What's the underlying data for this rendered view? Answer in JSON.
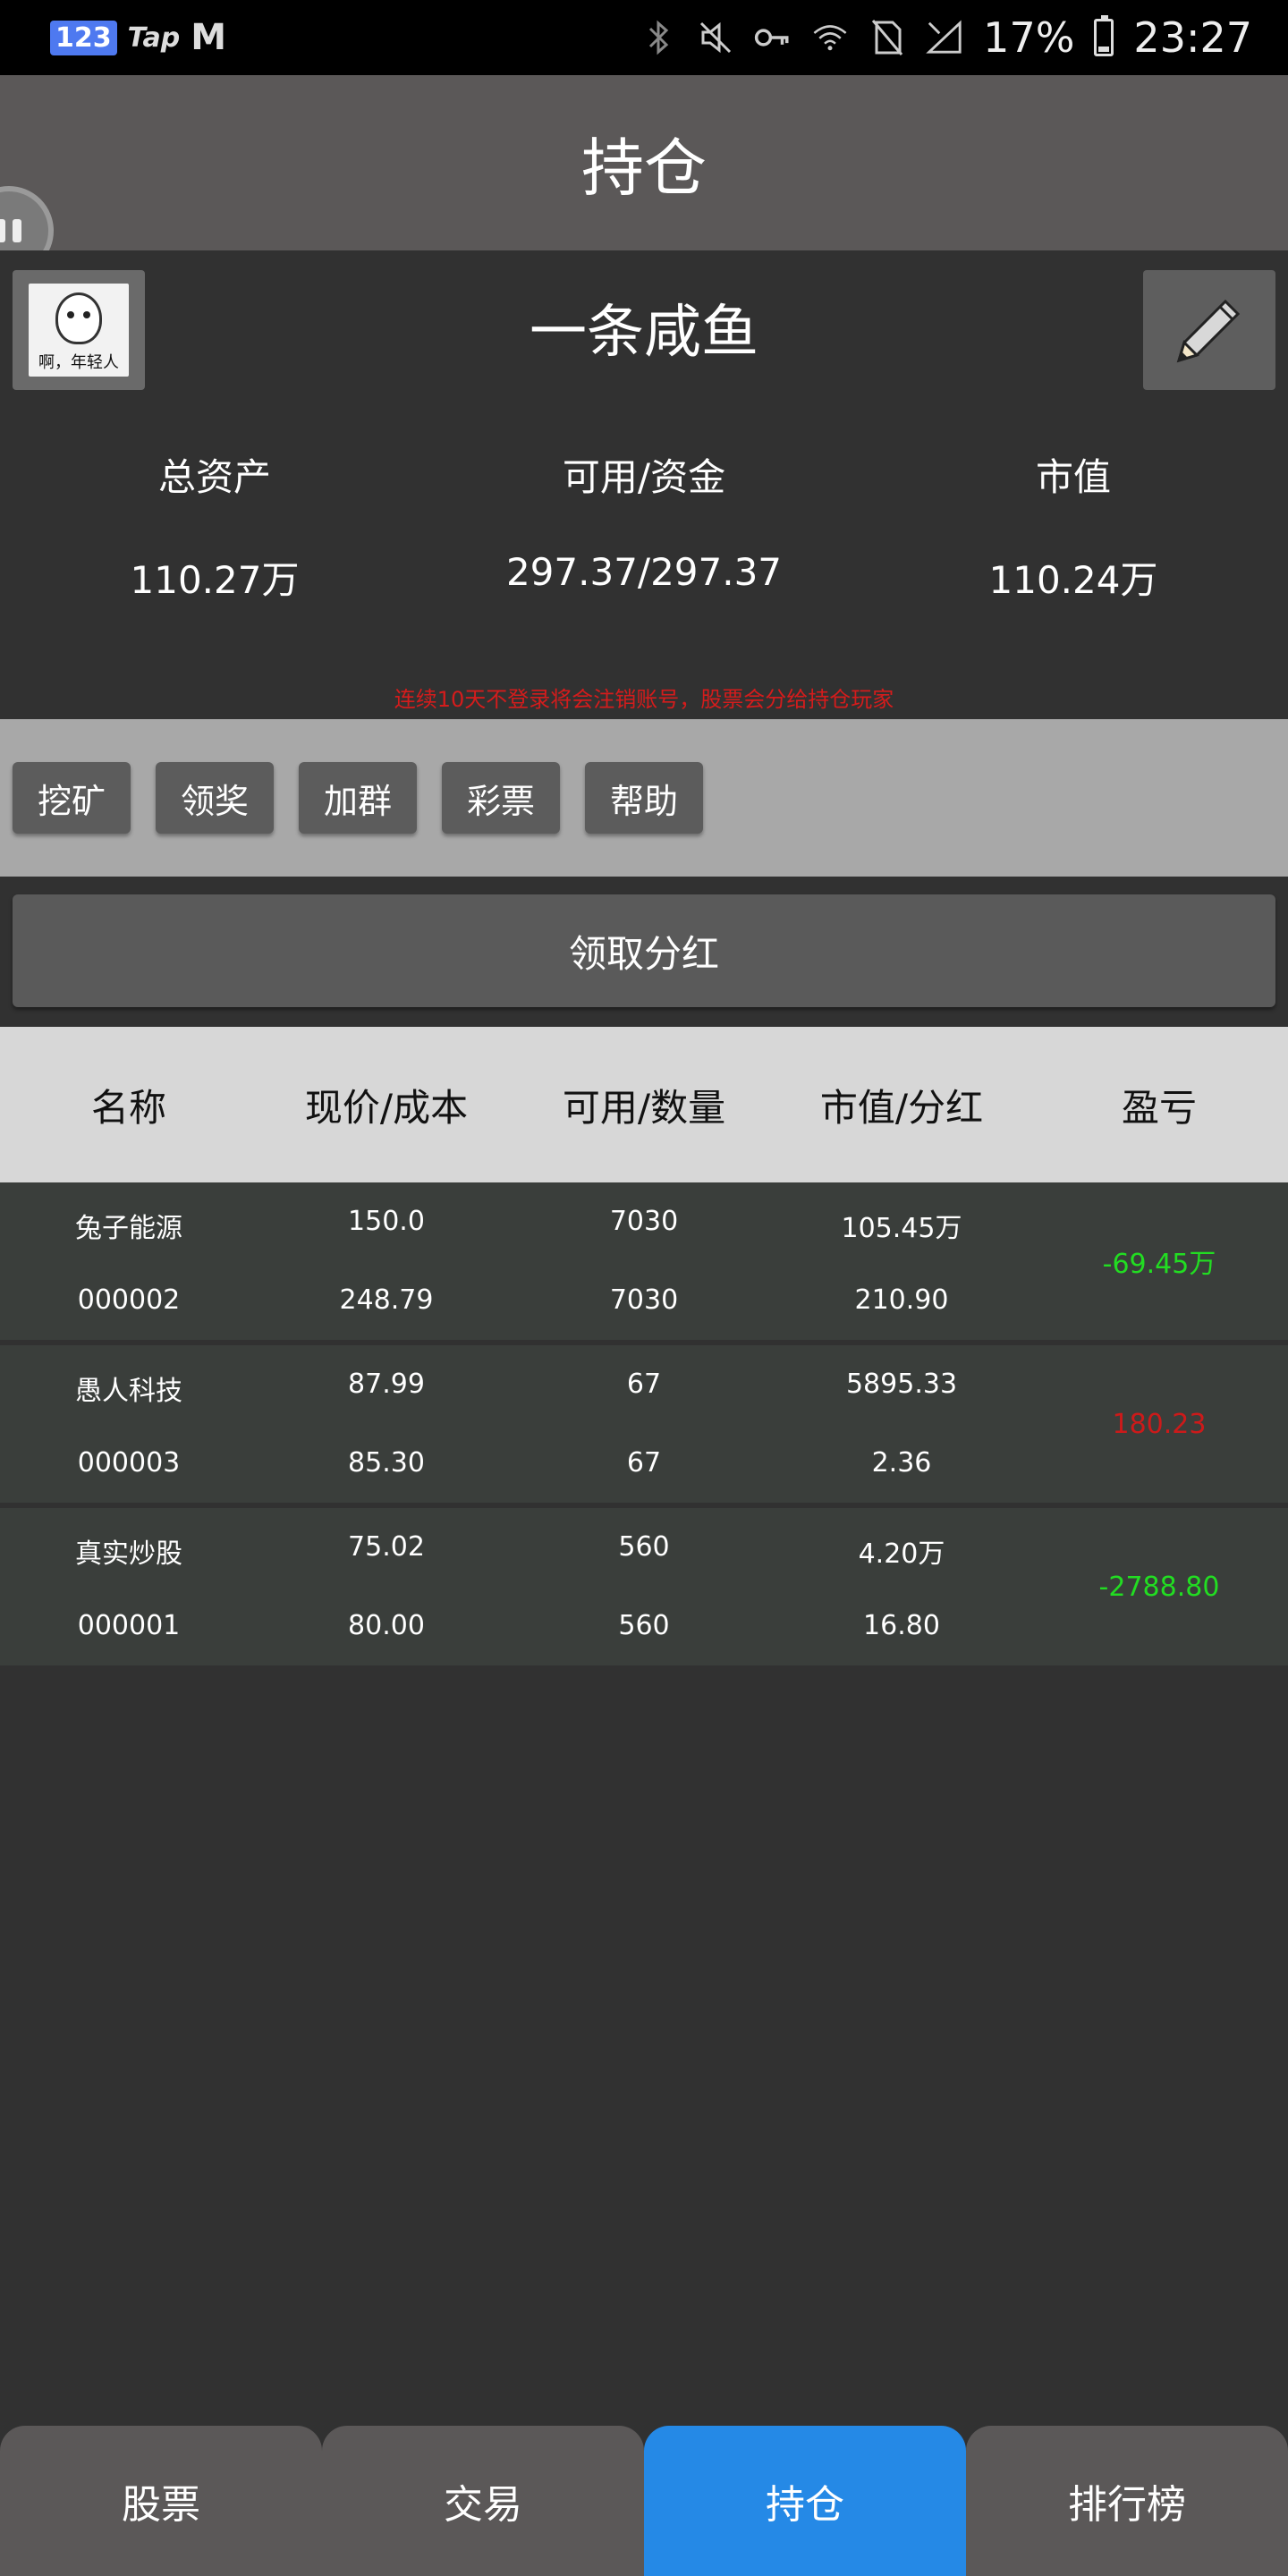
{
  "status_bar": {
    "app_icons": [
      "123",
      "Tap",
      "M"
    ],
    "battery": "17%",
    "time": "23:27"
  },
  "header": {
    "title": "持仓"
  },
  "profile": {
    "avatar_caption": "啊，年轻人",
    "username": "一条咸鱼",
    "stats": [
      {
        "label": "总资产",
        "value": "110.27万"
      },
      {
        "label": "可用/资金",
        "value": "297.37/297.37"
      },
      {
        "label": "市值",
        "value": "110.24万"
      }
    ],
    "warning": "连续10天不登录将会注销账号，股票会分给持仓玩家"
  },
  "actions": [
    "挖矿",
    "领奖",
    "加群",
    "彩票",
    "帮助"
  ],
  "dividend_button": "领取分红",
  "table": {
    "headers": [
      "名称",
      "现价/成本",
      "可用/数量",
      "市值/分红",
      "盈亏"
    ],
    "rows": [
      {
        "name": "兔子能源",
        "code": "000002",
        "price": "150.0",
        "cost": "248.79",
        "available": "7030",
        "quantity": "7030",
        "market_value": "105.45万",
        "dividend": "210.90",
        "pnl": "-69.45万",
        "pnl_color": "#22dd22"
      },
      {
        "name": "愚人科技",
        "code": "000003",
        "price": "87.99",
        "cost": "85.30",
        "available": "67",
        "quantity": "67",
        "market_value": "5895.33",
        "dividend": "2.36",
        "pnl": "180.23",
        "pnl_color": "#cc1a1a"
      },
      {
        "name": "真实炒股",
        "code": "000001",
        "price": "75.02",
        "cost": "80.00",
        "available": "560",
        "quantity": "560",
        "market_value": "4.20万",
        "dividend": "16.80",
        "pnl": "-2788.80",
        "pnl_color": "#22dd22"
      }
    ]
  },
  "bottom_nav": {
    "tabs": [
      "股票",
      "交易",
      "持仓",
      "排行榜"
    ],
    "active": "持仓",
    "active_color": "#2589e6"
  }
}
